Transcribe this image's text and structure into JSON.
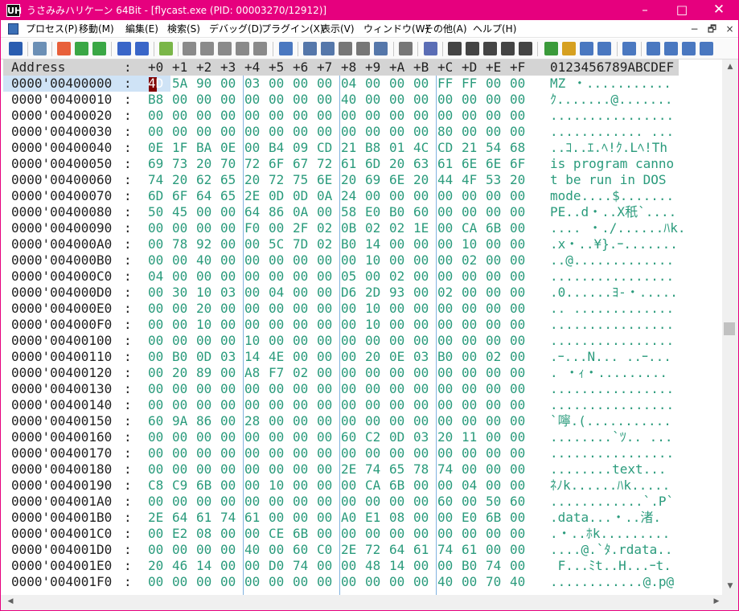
{
  "window": {
    "title": "うさみみハリケーン 64Bit - [flycast.exe (PID: 00003270/12912)]",
    "app_icon_text": "UH"
  },
  "menu": [
    "プロセス(P)",
    "移動(M)",
    "編集(E)",
    "検索(S)",
    "デバッグ(D)",
    "プラグイン(X)",
    "表示(V)",
    "ウィンドウ(W)",
    "その他(A)",
    "ヘルプ(H)"
  ],
  "mdi_buttons": [
    "−",
    "🗗",
    "×"
  ],
  "header": {
    "address": "Address",
    "colon": ":",
    "cols": [
      "+0",
      "+1",
      "+2",
      "+3",
      "+4",
      "+5",
      "+6",
      "+7",
      "+8",
      "+9",
      "+A",
      "+B",
      "+C",
      "+D",
      "+E",
      "+F"
    ],
    "ascii": "0123456789ABCDEF"
  },
  "rows": [
    {
      "addr": "0000'00400000",
      "bytes": [
        "4D",
        "5A",
        "90",
        "00",
        "03",
        "00",
        "00",
        "00",
        "04",
        "00",
        "00",
        "00",
        "FF",
        "FF",
        "00",
        "00"
      ],
      "ascii": "MZ ・..........."
    },
    {
      "addr": "0000'00400010",
      "bytes": [
        "B8",
        "00",
        "00",
        "00",
        "00",
        "00",
        "00",
        "00",
        "40",
        "00",
        "00",
        "00",
        "00",
        "00",
        "00",
        "00"
      ],
      "ascii": "ｸ.......@......."
    },
    {
      "addr": "0000'00400020",
      "bytes": [
        "00",
        "00",
        "00",
        "00",
        "00",
        "00",
        "00",
        "00",
        "00",
        "00",
        "00",
        "00",
        "00",
        "00",
        "00",
        "00"
      ],
      "ascii": "................"
    },
    {
      "addr": "0000'00400030",
      "bytes": [
        "00",
        "00",
        "00",
        "00",
        "00",
        "00",
        "00",
        "00",
        "00",
        "00",
        "00",
        "00",
        "80",
        "00",
        "00",
        "00"
      ],
      "ascii": "............ ..."
    },
    {
      "addr": "0000'00400040",
      "bytes": [
        "0E",
        "1F",
        "BA",
        "0E",
        "00",
        "B4",
        "09",
        "CD",
        "21",
        "B8",
        "01",
        "4C",
        "CD",
        "21",
        "54",
        "68"
      ],
      "ascii": "..ｺ..ｴ.ﾍ!ｸ.Lﾍ!Th"
    },
    {
      "addr": "0000'00400050",
      "bytes": [
        "69",
        "73",
        "20",
        "70",
        "72",
        "6F",
        "67",
        "72",
        "61",
        "6D",
        "20",
        "63",
        "61",
        "6E",
        "6E",
        "6F"
      ],
      "ascii": "is program canno"
    },
    {
      "addr": "0000'00400060",
      "bytes": [
        "74",
        "20",
        "62",
        "65",
        "20",
        "72",
        "75",
        "6E",
        "20",
        "69",
        "6E",
        "20",
        "44",
        "4F",
        "53",
        "20"
      ],
      "ascii": "t be run in DOS "
    },
    {
      "addr": "0000'00400070",
      "bytes": [
        "6D",
        "6F",
        "64",
        "65",
        "2E",
        "0D",
        "0D",
        "0A",
        "24",
        "00",
        "00",
        "00",
        "00",
        "00",
        "00",
        "00"
      ],
      "ascii": "mode....$......."
    },
    {
      "addr": "0000'00400080",
      "bytes": [
        "50",
        "45",
        "00",
        "00",
        "64",
        "86",
        "0A",
        "00",
        "58",
        "E0",
        "B0",
        "60",
        "00",
        "00",
        "00",
        "00"
      ],
      "ascii": "PE..d・..X秖`...."
    },
    {
      "addr": "0000'00400090",
      "bytes": [
        "00",
        "00",
        "00",
        "00",
        "F0",
        "00",
        "2F",
        "02",
        "0B",
        "02",
        "02",
        "1E",
        "00",
        "CA",
        "6B",
        "00"
      ],
      "ascii": ".... ・./......ﾊk."
    },
    {
      "addr": "0000'004000A0",
      "bytes": [
        "00",
        "78",
        "92",
        "00",
        "00",
        "5C",
        "7D",
        "02",
        "B0",
        "14",
        "00",
        "00",
        "00",
        "10",
        "00",
        "00"
      ],
      "ascii": ".x・..¥}.ｰ......."
    },
    {
      "addr": "0000'004000B0",
      "bytes": [
        "00",
        "00",
        "40",
        "00",
        "00",
        "00",
        "00",
        "00",
        "00",
        "10",
        "00",
        "00",
        "00",
        "02",
        "00",
        "00"
      ],
      "ascii": "..@............."
    },
    {
      "addr": "0000'004000C0",
      "bytes": [
        "04",
        "00",
        "00",
        "00",
        "00",
        "00",
        "00",
        "00",
        "05",
        "00",
        "02",
        "00",
        "00",
        "00",
        "00",
        "00"
      ],
      "ascii": "................"
    },
    {
      "addr": "0000'004000D0",
      "bytes": [
        "00",
        "30",
        "10",
        "03",
        "00",
        "04",
        "00",
        "00",
        "D6",
        "2D",
        "93",
        "00",
        "02",
        "00",
        "00",
        "00"
      ],
      "ascii": ".0......ﾖ-・....."
    },
    {
      "addr": "0000'004000E0",
      "bytes": [
        "00",
        "00",
        "20",
        "00",
        "00",
        "00",
        "00",
        "00",
        "00",
        "10",
        "00",
        "00",
        "00",
        "00",
        "00",
        "00"
      ],
      "ascii": ".. ............."
    },
    {
      "addr": "0000'004000F0",
      "bytes": [
        "00",
        "00",
        "10",
        "00",
        "00",
        "00",
        "00",
        "00",
        "00",
        "10",
        "00",
        "00",
        "00",
        "00",
        "00",
        "00"
      ],
      "ascii": "................"
    },
    {
      "addr": "0000'00400100",
      "bytes": [
        "00",
        "00",
        "00",
        "00",
        "10",
        "00",
        "00",
        "00",
        "00",
        "00",
        "00",
        "00",
        "00",
        "00",
        "00",
        "00"
      ],
      "ascii": "................"
    },
    {
      "addr": "0000'00400110",
      "bytes": [
        "00",
        "B0",
        "0D",
        "03",
        "14",
        "4E",
        "00",
        "00",
        "00",
        "20",
        "0E",
        "03",
        "B0",
        "00",
        "02",
        "00"
      ],
      "ascii": ".ｰ...N... ..ｰ..."
    },
    {
      "addr": "0000'00400120",
      "bytes": [
        "00",
        "20",
        "89",
        "00",
        "A8",
        "F7",
        "02",
        "00",
        "00",
        "00",
        "00",
        "00",
        "00",
        "00",
        "00",
        "00"
      ],
      "ascii": ". ・ｨ・........."
    },
    {
      "addr": "0000'00400130",
      "bytes": [
        "00",
        "00",
        "00",
        "00",
        "00",
        "00",
        "00",
        "00",
        "00",
        "00",
        "00",
        "00",
        "00",
        "00",
        "00",
        "00"
      ],
      "ascii": "................"
    },
    {
      "addr": "0000'00400140",
      "bytes": [
        "00",
        "00",
        "00",
        "00",
        "00",
        "00",
        "00",
        "00",
        "00",
        "00",
        "00",
        "00",
        "00",
        "00",
        "00",
        "00"
      ],
      "ascii": "................"
    },
    {
      "addr": "0000'00400150",
      "bytes": [
        "60",
        "9A",
        "86",
        "00",
        "28",
        "00",
        "00",
        "00",
        "00",
        "00",
        "00",
        "00",
        "00",
        "00",
        "00",
        "00"
      ],
      "ascii": "`嚀.(..........."
    },
    {
      "addr": "0000'00400160",
      "bytes": [
        "00",
        "00",
        "00",
        "00",
        "00",
        "00",
        "00",
        "00",
        "60",
        "C2",
        "0D",
        "03",
        "20",
        "11",
        "00",
        "00"
      ],
      "ascii": "........`ﾂ.. ..."
    },
    {
      "addr": "0000'00400170",
      "bytes": [
        "00",
        "00",
        "00",
        "00",
        "00",
        "00",
        "00",
        "00",
        "00",
        "00",
        "00",
        "00",
        "00",
        "00",
        "00",
        "00"
      ],
      "ascii": "................"
    },
    {
      "addr": "0000'00400180",
      "bytes": [
        "00",
        "00",
        "00",
        "00",
        "00",
        "00",
        "00",
        "00",
        "2E",
        "74",
        "65",
        "78",
        "74",
        "00",
        "00",
        "00"
      ],
      "ascii": "........text..."
    },
    {
      "addr": "0000'00400190",
      "bytes": [
        "C8",
        "C9",
        "6B",
        "00",
        "00",
        "10",
        "00",
        "00",
        "00",
        "CA",
        "6B",
        "00",
        "00",
        "04",
        "00",
        "00"
      ],
      "ascii": "ﾈﾉk......ﾊk....."
    },
    {
      "addr": "0000'004001A0",
      "bytes": [
        "00",
        "00",
        "00",
        "00",
        "00",
        "00",
        "00",
        "00",
        "00",
        "00",
        "00",
        "00",
        "60",
        "00",
        "50",
        "60"
      ],
      "ascii": "............`.P`"
    },
    {
      "addr": "0000'004001B0",
      "bytes": [
        "2E",
        "64",
        "61",
        "74",
        "61",
        "00",
        "00",
        "00",
        "A0",
        "E1",
        "08",
        "00",
        "00",
        "E0",
        "6B",
        "00"
      ],
      "ascii": ".data...・..渚."
    },
    {
      "addr": "0000'004001C0",
      "bytes": [
        "00",
        "E2",
        "08",
        "00",
        "00",
        "CE",
        "6B",
        "00",
        "00",
        "00",
        "00",
        "00",
        "00",
        "00",
        "00",
        "00"
      ],
      "ascii": ".・..ﾎk........."
    },
    {
      "addr": "0000'004001D0",
      "bytes": [
        "00",
        "00",
        "00",
        "00",
        "40",
        "00",
        "60",
        "C0",
        "2E",
        "72",
        "64",
        "61",
        "74",
        "61",
        "00",
        "00"
      ],
      "ascii": "....@.`ﾀ.rdata.."
    },
    {
      "addr": "0000'004001E0",
      "bytes": [
        "20",
        "46",
        "14",
        "00",
        "00",
        "D0",
        "74",
        "00",
        "00",
        "48",
        "14",
        "00",
        "00",
        "B0",
        "74",
        "00"
      ],
      "ascii": " F...ﾐt..H...ｰt."
    },
    {
      "addr": "0000'004001F0",
      "bytes": [
        "00",
        "00",
        "00",
        "00",
        "00",
        "00",
        "00",
        "00",
        "00",
        "00",
        "00",
        "00",
        "40",
        "00",
        "70",
        "40"
      ],
      "ascii": "............@.p@"
    }
  ]
}
